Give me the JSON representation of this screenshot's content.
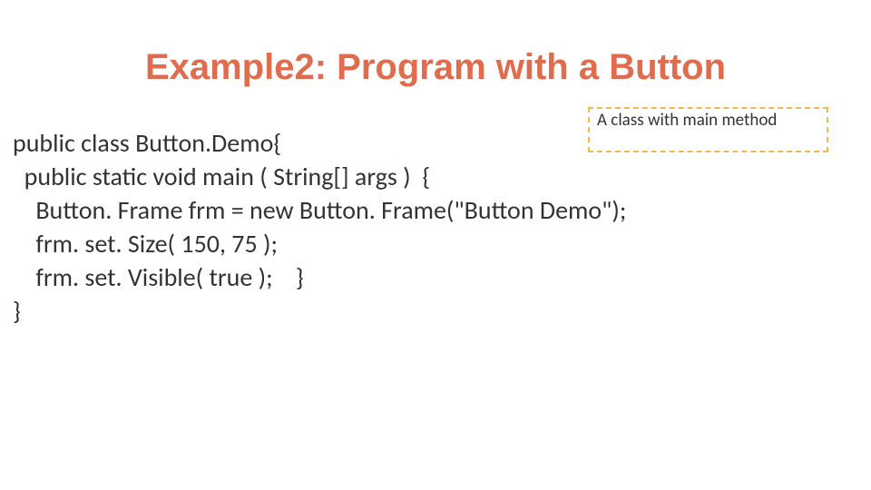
{
  "title": "Example2: Program with a Button",
  "callout": "A class with main method",
  "code": {
    "l1": "public class Button.Demo{",
    "l2": "  public static void main ( String[] args )  {",
    "l3": "    Button. Frame frm = new Button. Frame(\"Button Demo\");",
    "l4": "    frm. set. Size( 150, 75 );",
    "l5": "    frm. set. Visible( true );    }",
    "l6": "}"
  }
}
